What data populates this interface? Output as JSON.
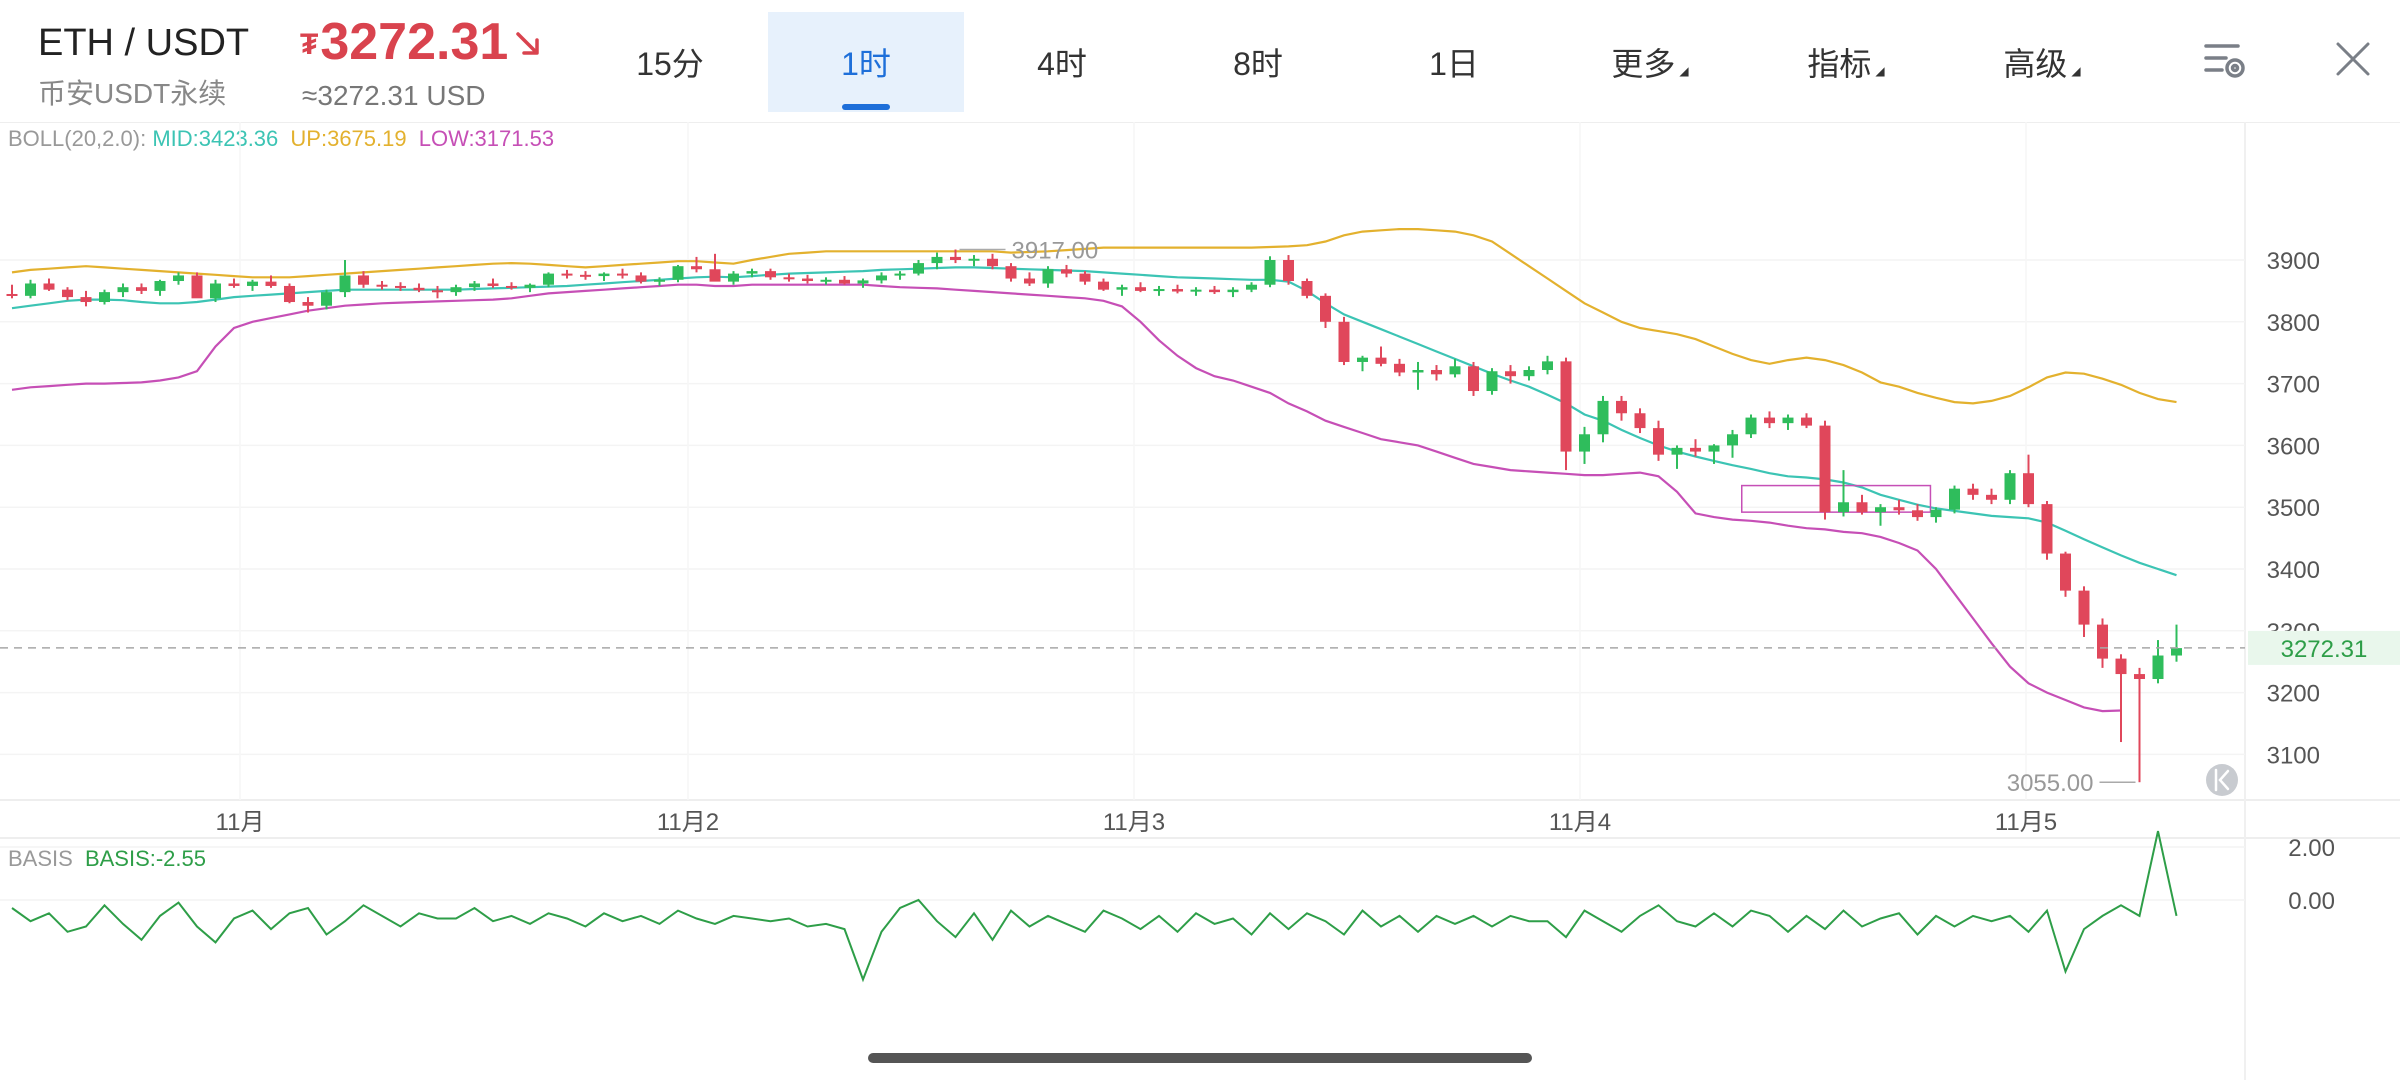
{
  "header": {
    "pair": "ETH / USDT",
    "subtitle": "币安USDT永续",
    "price_currency": "₮",
    "price": "3272.31",
    "price_usd": "≈3272.31 USD",
    "price_color": "#d9434e"
  },
  "tabs": [
    {
      "label": "15分",
      "active": false
    },
    {
      "label": "1时",
      "active": true
    },
    {
      "label": "4时",
      "active": false
    },
    {
      "label": "8时",
      "active": false
    },
    {
      "label": "1日",
      "active": false
    },
    {
      "label": "更多",
      "active": false,
      "dropdown": true
    },
    {
      "label": "指标",
      "active": false,
      "dropdown": true
    },
    {
      "label": "高级",
      "active": false,
      "dropdown": true
    }
  ],
  "icons": {
    "settings": "chart-settings-icon",
    "close": "close-icon",
    "scroll_end": "scroll-to-latest-icon",
    "trend": "down-arrow-icon"
  },
  "boll": {
    "label": "BOLL(20,2.0):",
    "mid": "MID:3423.36",
    "up": "UP:3675.19",
    "low": "LOW:3171.53",
    "colors": {
      "mid": "#3cc4b4",
      "up": "#e3b12e",
      "low": "#c64fb6",
      "label": "#999999"
    }
  },
  "basis_legend": {
    "label": "BASIS",
    "value": "BASIS:-2.55",
    "color": "#2e9e48"
  },
  "chart_data": {
    "type": "candlestick",
    "up_color": "#2fbd5c",
    "down_color": "#e0475b",
    "y_ticks": [
      "3900",
      "3800",
      "3700",
      "3600",
      "3500",
      "3400",
      "3300",
      "3200",
      "3100"
    ],
    "x_labels": [
      "11月",
      "11月2",
      "11月3",
      "11月4",
      "11月5"
    ],
    "current_price": "3272.31",
    "high_label": "3917.00",
    "low_label": "3055.00",
    "candles": [
      [
        3845,
        3860,
        3838,
        3842
      ],
      [
        3842,
        3868,
        3838,
        3862
      ],
      [
        3862,
        3870,
        3850,
        3852
      ],
      [
        3852,
        3856,
        3835,
        3840
      ],
      [
        3840,
        3850,
        3825,
        3832
      ],
      [
        3832,
        3852,
        3828,
        3848
      ],
      [
        3848,
        3862,
        3840,
        3856
      ],
      [
        3856,
        3862,
        3845,
        3850
      ],
      [
        3850,
        3868,
        3842,
        3866
      ],
      [
        3866,
        3880,
        3860,
        3875
      ],
      [
        3875,
        3880,
        3850,
        3838
      ],
      [
        3838,
        3868,
        3832,
        3862
      ],
      [
        3862,
        3870,
        3855,
        3858
      ],
      [
        3858,
        3868,
        3850,
        3865
      ],
      [
        3865,
        3875,
        3855,
        3858
      ],
      [
        3858,
        3862,
        3830,
        3832
      ],
      [
        3832,
        3840,
        3815,
        3826
      ],
      [
        3826,
        3852,
        3820,
        3848
      ],
      [
        3848,
        3900,
        3840,
        3875
      ],
      [
        3875,
        3882,
        3855,
        3860
      ],
      [
        3860,
        3866,
        3852,
        3858
      ],
      [
        3858,
        3864,
        3850,
        3855
      ],
      [
        3855,
        3862,
        3848,
        3851
      ],
      [
        3851,
        3858,
        3838,
        3848
      ],
      [
        3848,
        3860,
        3842,
        3856
      ],
      [
        3856,
        3866,
        3850,
        3862
      ],
      [
        3862,
        3870,
        3855,
        3858
      ],
      [
        3858,
        3864,
        3852,
        3855
      ],
      [
        3855,
        3862,
        3848,
        3860
      ],
      [
        3860,
        3880,
        3856,
        3878
      ],
      [
        3878,
        3884,
        3870,
        3876
      ],
      [
        3876,
        3882,
        3868,
        3874
      ],
      [
        3874,
        3880,
        3866,
        3878
      ],
      [
        3878,
        3886,
        3870,
        3875
      ],
      [
        3875,
        3880,
        3862,
        3865
      ],
      [
        3865,
        3872,
        3858,
        3868
      ],
      [
        3868,
        3892,
        3864,
        3890
      ],
      [
        3890,
        3905,
        3880,
        3885
      ],
      [
        3885,
        3910,
        3870,
        3865
      ],
      [
        3865,
        3882,
        3860,
        3878
      ],
      [
        3878,
        3886,
        3872,
        3882
      ],
      [
        3882,
        3886,
        3868,
        3872
      ],
      [
        3872,
        3878,
        3865,
        3870
      ],
      [
        3870,
        3876,
        3862,
        3866
      ],
      [
        3866,
        3872,
        3860,
        3868
      ],
      [
        3868,
        3874,
        3860,
        3862
      ],
      [
        3862,
        3870,
        3855,
        3867
      ],
      [
        3867,
        3880,
        3862,
        3875
      ],
      [
        3875,
        3882,
        3868,
        3878
      ],
      [
        3878,
        3900,
        3875,
        3895
      ],
      [
        3895,
        3912,
        3885,
        3905
      ],
      [
        3905,
        3917,
        3895,
        3900
      ],
      [
        3900,
        3908,
        3890,
        3902
      ],
      [
        3902,
        3910,
        3885,
        3890
      ],
      [
        3890,
        3895,
        3865,
        3870
      ],
      [
        3870,
        3880,
        3858,
        3862
      ],
      [
        3862,
        3890,
        3855,
        3885
      ],
      [
        3885,
        3892,
        3872,
        3878
      ],
      [
        3878,
        3882,
        3860,
        3865
      ],
      [
        3865,
        3870,
        3850,
        3852
      ],
      [
        3852,
        3860,
        3842,
        3856
      ],
      [
        3856,
        3864,
        3848,
        3850
      ],
      [
        3850,
        3858,
        3842,
        3853
      ],
      [
        3853,
        3860,
        3846,
        3849
      ],
      [
        3849,
        3856,
        3842,
        3852
      ],
      [
        3852,
        3858,
        3845,
        3848
      ],
      [
        3848,
        3856,
        3840,
        3852
      ],
      [
        3852,
        3864,
        3848,
        3860
      ],
      [
        3860,
        3906,
        3856,
        3900
      ],
      [
        3900,
        3908,
        3860,
        3866
      ],
      [
        3866,
        3870,
        3838,
        3842
      ],
      [
        3842,
        3846,
        3790,
        3800
      ],
      [
        3800,
        3808,
        3730,
        3735
      ],
      [
        3735,
        3745,
        3720,
        3742
      ],
      [
        3742,
        3760,
        3728,
        3732
      ],
      [
        3732,
        3740,
        3712,
        3718
      ],
      [
        3718,
        3735,
        3690,
        3722
      ],
      [
        3722,
        3730,
        3705,
        3715
      ],
      [
        3715,
        3740,
        3710,
        3728
      ],
      [
        3728,
        3735,
        3680,
        3688
      ],
      [
        3688,
        3725,
        3682,
        3720
      ],
      [
        3720,
        3730,
        3700,
        3712
      ],
      [
        3712,
        3728,
        3705,
        3722
      ],
      [
        3722,
        3745,
        3715,
        3736
      ],
      [
        3736,
        3742,
        3560,
        3590
      ],
      [
        3590,
        3630,
        3570,
        3618
      ],
      [
        3618,
        3680,
        3605,
        3672
      ],
      [
        3672,
        3680,
        3640,
        3652
      ],
      [
        3652,
        3660,
        3620,
        3628
      ],
      [
        3628,
        3640,
        3575,
        3585
      ],
      [
        3585,
        3600,
        3562,
        3596
      ],
      [
        3596,
        3610,
        3582,
        3590
      ],
      [
        3590,
        3602,
        3570,
        3600
      ],
      [
        3600,
        3625,
        3580,
        3618
      ],
      [
        3618,
        3650,
        3612,
        3645
      ],
      [
        3645,
        3655,
        3628,
        3636
      ],
      [
        3636,
        3650,
        3625,
        3645
      ],
      [
        3645,
        3652,
        3628,
        3632
      ],
      [
        3632,
        3640,
        3480,
        3492
      ],
      [
        3492,
        3560,
        3485,
        3508
      ],
      [
        3508,
        3520,
        3488,
        3492
      ],
      [
        3492,
        3505,
        3470,
        3500
      ],
      [
        3500,
        3512,
        3488,
        3495
      ],
      [
        3495,
        3505,
        3478,
        3484
      ],
      [
        3484,
        3500,
        3475,
        3496
      ],
      [
        3496,
        3535,
        3490,
        3530
      ],
      [
        3530,
        3538,
        3512,
        3520
      ],
      [
        3520,
        3530,
        3505,
        3512
      ],
      [
        3512,
        3560,
        3505,
        3555
      ],
      [
        3555,
        3585,
        3500,
        3505
      ],
      [
        3505,
        3510,
        3415,
        3425
      ],
      [
        3425,
        3428,
        3355,
        3365
      ],
      [
        3365,
        3372,
        3290,
        3310
      ],
      [
        3310,
        3320,
        3240,
        3255
      ],
      [
        3255,
        3262,
        3120,
        3230
      ],
      [
        3230,
        3240,
        3055,
        3222
      ],
      [
        3222,
        3285,
        3215,
        3260
      ],
      [
        3260,
        3310,
        3250,
        3272
      ]
    ],
    "boll_up": [
      3880,
      3884,
      3886,
      3888,
      3890,
      3888,
      3886,
      3884,
      3882,
      3880,
      3878,
      3876,
      3874,
      3872,
      3872,
      3872,
      3874,
      3876,
      3878,
      3880,
      3882,
      3884,
      3886,
      3888,
      3890,
      3892,
      3894,
      3895,
      3894,
      3892,
      3890,
      3888,
      3890,
      3892,
      3894,
      3896,
      3898,
      3898,
      3896,
      3894,
      3900,
      3905,
      3910,
      3912,
      3914,
      3914,
      3914,
      3914,
      3914,
      3914,
      3914,
      3914,
      3914,
      3914,
      3912,
      3913,
      3914,
      3916,
      3918,
      3920,
      3920,
      3920,
      3920,
      3920,
      3920,
      3920,
      3920,
      3920,
      3921,
      3922,
      3924,
      3930,
      3940,
      3946,
      3948,
      3950,
      3950,
      3948,
      3946,
      3940,
      3930,
      3910,
      3890,
      3870,
      3850,
      3830,
      3815,
      3800,
      3790,
      3785,
      3780,
      3772,
      3760,
      3748,
      3738,
      3732,
      3738,
      3742,
      3738,
      3730,
      3718,
      3702,
      3695,
      3685,
      3677,
      3670,
      3668,
      3672,
      3680,
      3694,
      3710,
      3718,
      3716,
      3708,
      3698,
      3685,
      3675,
      3670
    ],
    "boll_mid": [
      3822,
      3826,
      3830,
      3834,
      3836,
      3836,
      3835,
      3832,
      3830,
      3830,
      3832,
      3836,
      3840,
      3842,
      3844,
      3846,
      3848,
      3850,
      3852,
      3852,
      3852,
      3852,
      3852,
      3852,
      3852,
      3853,
      3854,
      3855,
      3856,
      3857,
      3858,
      3860,
      3862,
      3864,
      3866,
      3868,
      3870,
      3872,
      3873,
      3872,
      3874,
      3876,
      3878,
      3879,
      3880,
      3881,
      3882,
      3884,
      3885,
      3886,
      3887,
      3888,
      3888,
      3887,
      3886,
      3885,
      3884,
      3883,
      3882,
      3880,
      3878,
      3876,
      3874,
      3872,
      3871,
      3870,
      3869,
      3868,
      3868,
      3865,
      3850,
      3830,
      3812,
      3800,
      3788,
      3776,
      3764,
      3752,
      3740,
      3728,
      3716,
      3705,
      3695,
      3682,
      3668,
      3650,
      3640,
      3625,
      3612,
      3600,
      3590,
      3582,
      3575,
      3568,
      3562,
      3555,
      3550,
      3548,
      3545,
      3540,
      3532,
      3520,
      3512,
      3504,
      3498,
      3494,
      3490,
      3486,
      3484,
      3482,
      3475,
      3462,
      3448,
      3435,
      3422,
      3410,
      3400,
      3390
    ],
    "boll_low": [
      3690,
      3694,
      3696,
      3698,
      3700,
      3700,
      3701,
      3702,
      3705,
      3710,
      3720,
      3760,
      3790,
      3800,
      3806,
      3812,
      3818,
      3822,
      3826,
      3828,
      3830,
      3831,
      3832,
      3833,
      3834,
      3835,
      3836,
      3838,
      3842,
      3846,
      3848,
      3850,
      3852,
      3854,
      3856,
      3858,
      3860,
      3860,
      3858,
      3858,
      3860,
      3860,
      3860,
      3860,
      3860,
      3860,
      3860,
      3858,
      3856,
      3855,
      3854,
      3852,
      3850,
      3848,
      3846,
      3844,
      3842,
      3840,
      3838,
      3834,
      3825,
      3800,
      3770,
      3745,
      3725,
      3712,
      3705,
      3695,
      3685,
      3668,
      3655,
      3640,
      3630,
      3620,
      3610,
      3605,
      3600,
      3590,
      3580,
      3570,
      3565,
      3560,
      3558,
      3556,
      3554,
      3552,
      3552,
      3554,
      3556,
      3550,
      3525,
      3490,
      3484,
      3480,
      3478,
      3475,
      3470,
      3466,
      3464,
      3460,
      3458,
      3452,
      3442,
      3430,
      3400,
      3360,
      3320,
      3280,
      3242,
      3215,
      3200,
      3188,
      3176,
      3170,
      3171
    ],
    "basis_ticks": [
      "2.00",
      "0.00"
    ],
    "basis": [
      -0.3,
      -0.8,
      -0.5,
      -1.2,
      -1.0,
      -0.2,
      -0.9,
      -1.5,
      -0.6,
      -0.1,
      -1.0,
      -1.6,
      -0.7,
      -0.4,
      -1.1,
      -0.5,
      -0.3,
      -1.3,
      -0.8,
      -0.2,
      -0.6,
      -1.0,
      -0.5,
      -0.7,
      -0.7,
      -0.3,
      -0.8,
      -0.6,
      -0.9,
      -0.5,
      -0.7,
      -1.0,
      -0.5,
      -0.8,
      -0.6,
      -0.9,
      -0.4,
      -0.7,
      -0.9,
      -0.6,
      -0.7,
      -0.8,
      -0.7,
      -1.0,
      -0.9,
      -1.1,
      -3.0,
      -1.2,
      -0.3,
      0.0,
      -0.8,
      -1.4,
      -0.5,
      -1.5,
      -0.4,
      -1.0,
      -0.6,
      -0.9,
      -1.2,
      -0.4,
      -0.7,
      -1.1,
      -0.6,
      -1.2,
      -0.5,
      -0.9,
      -0.7,
      -1.3,
      -0.5,
      -1.1,
      -0.5,
      -0.8,
      -1.3,
      -0.4,
      -1.0,
      -0.6,
      -1.2,
      -0.6,
      -0.9,
      -0.6,
      -1.0,
      -0.6,
      -0.8,
      -0.8,
      -1.4,
      -0.4,
      -0.8,
      -1.2,
      -0.6,
      -0.2,
      -0.8,
      -1.0,
      -0.5,
      -1.0,
      -0.4,
      -0.6,
      -1.2,
      -0.6,
      -1.1,
      -0.4,
      -1.0,
      -0.7,
      -0.5,
      -1.3,
      -0.6,
      -1.0,
      -0.6,
      -0.8,
      -0.6,
      -1.2,
      -0.4,
      -2.7,
      -1.1,
      -0.6,
      -0.2,
      -0.6,
      2.6,
      -0.6
    ]
  }
}
